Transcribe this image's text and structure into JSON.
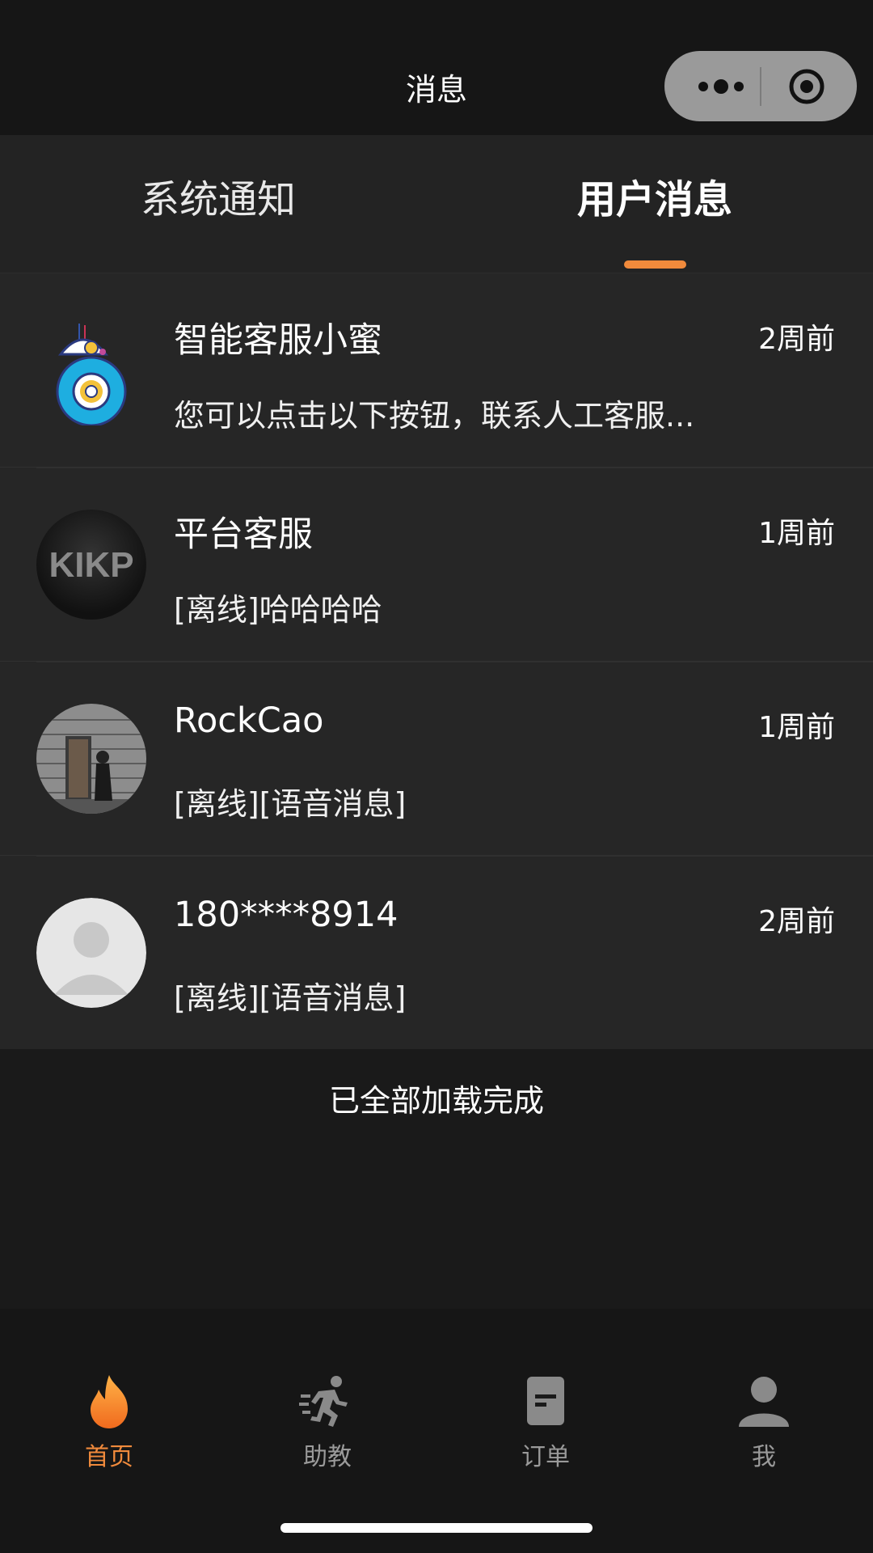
{
  "navbar": {
    "title": "消息",
    "capsule": {
      "more_icon": "more-dots-icon",
      "close_icon": "target-icon"
    }
  },
  "tabs": [
    {
      "label": "系统通知",
      "active": false
    },
    {
      "label": "用户消息",
      "active": true
    }
  ],
  "messages": [
    {
      "name": "智能客服小蜜",
      "time": "2周前",
      "preview": "您可以点击以下按钮，联系人工客服...",
      "avatar": "robot-avatar"
    },
    {
      "name": "平台客服",
      "time": "1周前",
      "preview": "[离线]哈哈哈哈",
      "avatar": "kikp-logo-avatar",
      "avatar_text": "KIKP"
    },
    {
      "name": "RockCao",
      "time": "1周前",
      "preview": "[离线][语音消息]",
      "avatar": "photo-avatar"
    },
    {
      "name": "180****8914",
      "time": "2周前",
      "preview": "[离线][语音消息]",
      "avatar": "default-user-avatar"
    }
  ],
  "status": {
    "loaded": "已全部加载完成"
  },
  "tabbar": [
    {
      "label": "首页",
      "icon": "flame-icon",
      "active": true
    },
    {
      "label": "助教",
      "icon": "running-person-icon",
      "active": false
    },
    {
      "label": "订单",
      "icon": "document-icon",
      "active": false
    },
    {
      "label": "我",
      "icon": "person-icon",
      "active": false
    }
  ],
  "colors": {
    "accent": "#f08a3c",
    "background": "#1a1a1a",
    "row": "#262626"
  }
}
